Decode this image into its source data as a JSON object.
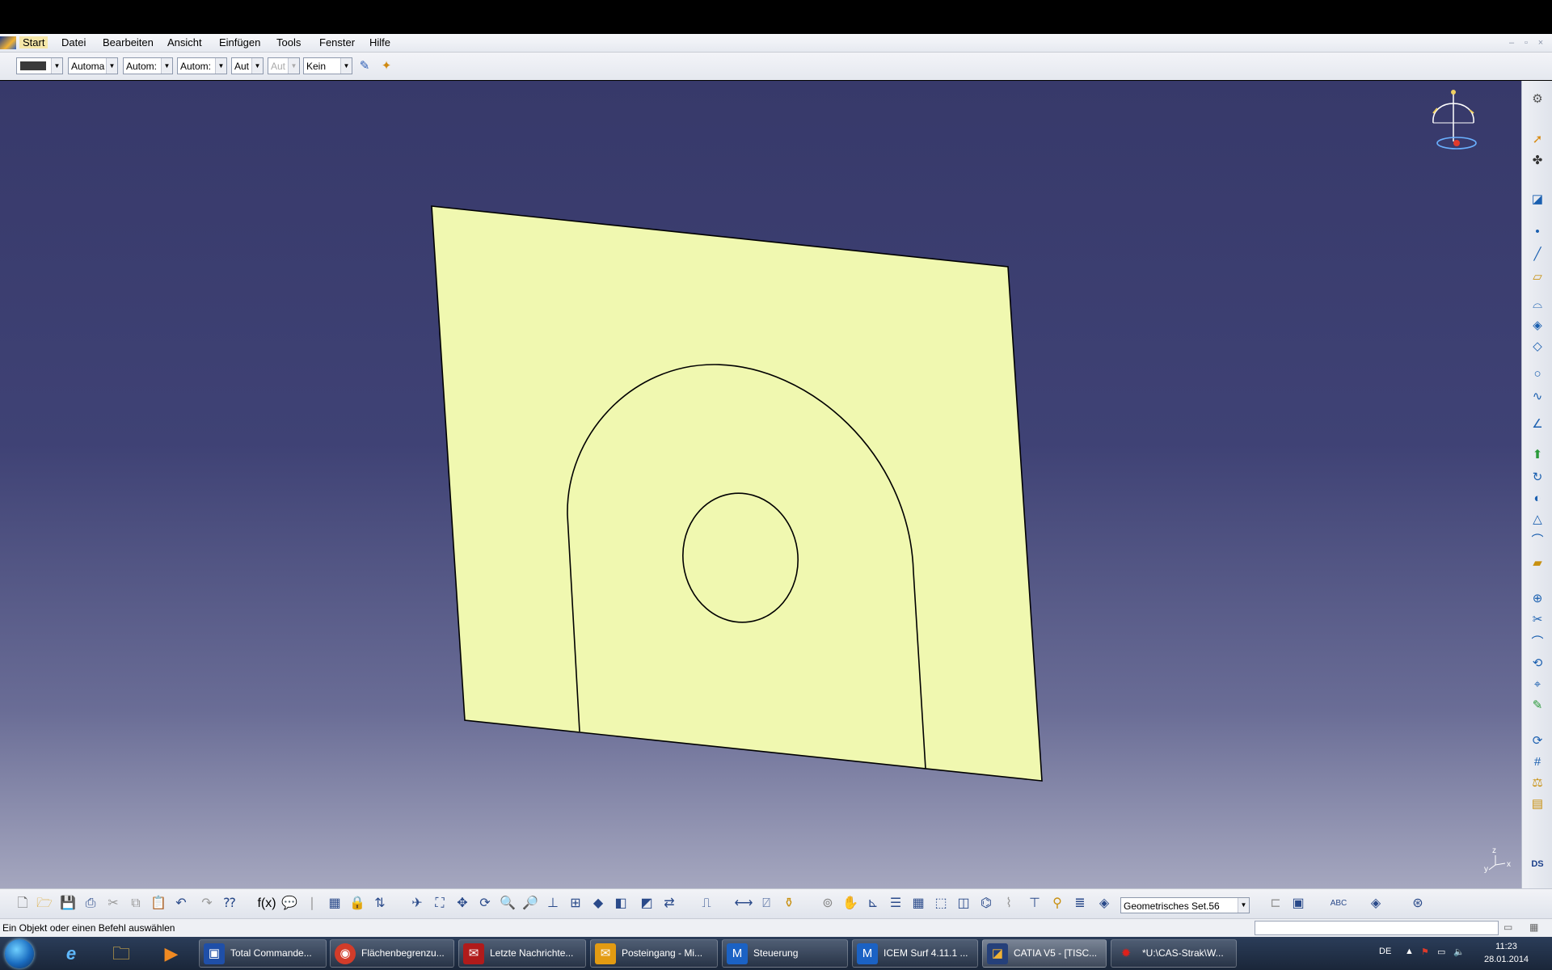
{
  "menu": {
    "items": [
      "Start",
      "Datei",
      "Bearbeiten",
      "Ansicht",
      "Einfügen",
      "Tools",
      "Fenster",
      "Hilfe"
    ],
    "window_controls": [
      "–",
      "▫",
      "×"
    ]
  },
  "properties_toolbar": {
    "combo_1": "Automa",
    "combo_2": "Autom:",
    "combo_3": "Autom:",
    "combo_4": "Aut",
    "combo_5": "Aut",
    "combo_6": "Kein"
  },
  "viewport": {
    "background_top": "#37396a",
    "background_bottom": "#a5a7bf",
    "surface_color": "#f0f8b0",
    "compass_axes": [
      "x",
      "y",
      "z"
    ]
  },
  "bottom_toolbar": {
    "set_selector": "Geometrisches Set.56"
  },
  "status": {
    "message": "Ein Objekt oder einen Befehl auswählen"
  },
  "taskbar": {
    "tasks": [
      {
        "label": "Total Commande...",
        "color": "#1f4fa8"
      },
      {
        "label": "Flächenbegrenzu...",
        "color": "#d23c2a"
      },
      {
        "label": "Letzte Nachrichte...",
        "color": "#b01b1b"
      },
      {
        "label": "Posteingang - Mi...",
        "color": "#e39b12"
      },
      {
        "label": "Steuerung",
        "color": "#1b62c4"
      },
      {
        "label": "ICEM Surf 4.11.1 ...",
        "color": "#1b62c4"
      },
      {
        "label": "CATIA V5 - [TISC...",
        "color": "#25407a"
      },
      {
        "label": "*U:\\CAS-Strak\\W...",
        "color": "#cc1a1a"
      }
    ],
    "language": "DE",
    "time": "11:23",
    "date": "28.01.2014"
  }
}
